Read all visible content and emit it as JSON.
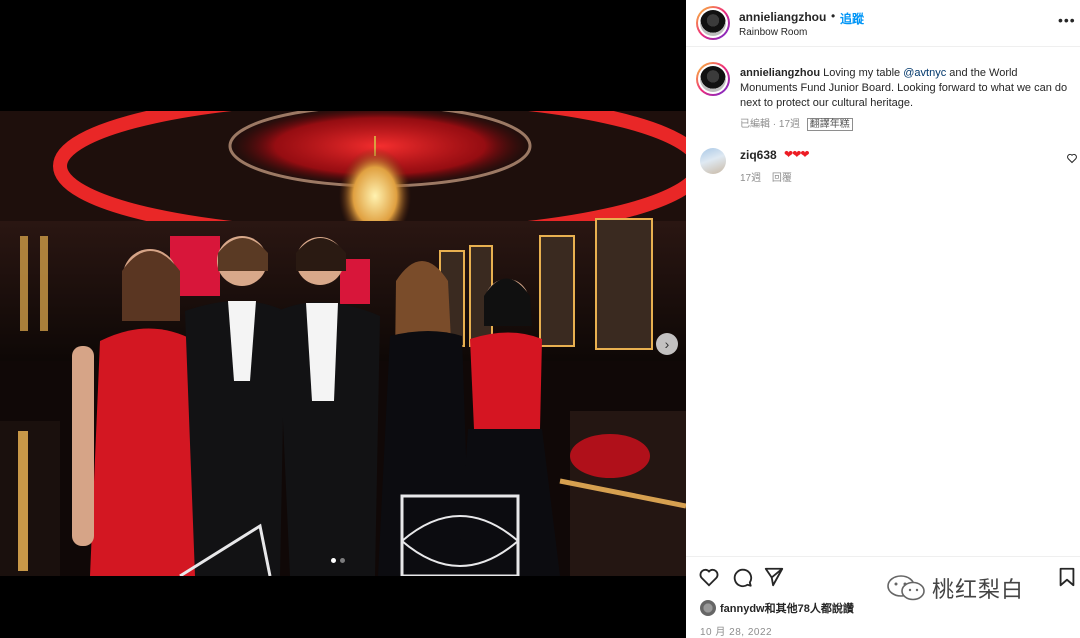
{
  "post": {
    "photo_alt": "Group photo of five people in formal wear at an event under a red-lit dome with a chandelier"
  },
  "header": {
    "username": "annieliangzhou",
    "separator": "•",
    "follow_label": "追蹤",
    "location": "Rainbow Room",
    "more_label": "•••"
  },
  "caption": {
    "username": "annieliangzhou",
    "text_before": "Loving my table ",
    "mention": "@avtnyc",
    "text_after": " and the World Monuments Fund Junior Board. Looking forward to what we can do next to protect our cultural heritage.",
    "edited": "已編輯",
    "age": "17週",
    "translate_label": "翻譯年糕"
  },
  "comments": [
    {
      "username": "ziq638",
      "body": "❤❤❤",
      "age": "17週",
      "reply_label": "回覆"
    }
  ],
  "likes": {
    "text": "fannydw和其他78人都說讚"
  },
  "date": "10 月 28, 2022",
  "watermark": {
    "text": "桃红梨白"
  },
  "carousel": {
    "current": 1,
    "total": 2
  },
  "colors": {
    "follow_blue": "#0095f6",
    "mention_blue": "#00376b",
    "meta_gray": "#8e8e8e",
    "heart_red": "#ed1c24"
  }
}
